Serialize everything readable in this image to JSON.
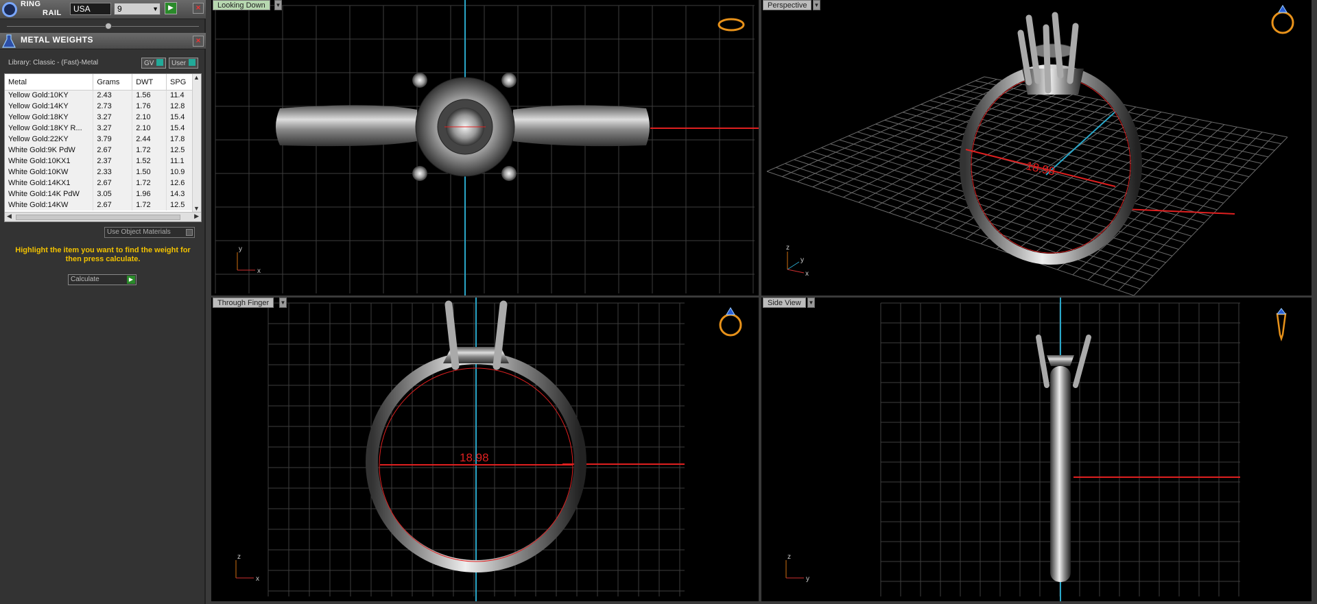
{
  "ring_rail": {
    "title_line1": "RING",
    "title_line2": "RAIL",
    "country": "USA",
    "size": "9"
  },
  "metal_weights": {
    "title": "METAL WEIGHTS",
    "library": "Library: Classic - (Fast)-Metal",
    "toggle_gv": "GV",
    "toggle_user": "User",
    "columns": [
      "Metal",
      "Grams",
      "DWT",
      "SPG"
    ],
    "rows": [
      [
        "Yellow Gold:10KY",
        "2.43",
        "1.56",
        "11.4"
      ],
      [
        "Yellow Gold:14KY",
        "2.73",
        "1.76",
        "12.8"
      ],
      [
        "Yellow Gold:18KY",
        "3.27",
        "2.10",
        "15.4"
      ],
      [
        "Yellow Gold:18KY R...",
        "3.27",
        "2.10",
        "15.4"
      ],
      [
        "Yellow Gold:22KY",
        "3.79",
        "2.44",
        "17.8"
      ],
      [
        "White Gold:9K PdW",
        "2.67",
        "1.72",
        "12.5"
      ],
      [
        "White Gold:10KX1",
        "2.37",
        "1.52",
        "11.1"
      ],
      [
        "White Gold:10KW",
        "2.33",
        "1.50",
        "10.9"
      ],
      [
        "White Gold:14KX1",
        "2.67",
        "1.72",
        "12.6"
      ],
      [
        "White Gold:14K PdW",
        "3.05",
        "1.96",
        "14.3"
      ],
      [
        "White Gold:14KW",
        "2.67",
        "1.72",
        "12.5"
      ]
    ],
    "use_object_materials": "Use Object Materials",
    "hint": "Highlight the item you want to find the weight for then press calculate.",
    "calculate": "Calculate"
  },
  "viewports": {
    "top_left": {
      "label": "Looking Down",
      "axis_a": "y",
      "axis_b": "x"
    },
    "top_right": {
      "label": "Perspective",
      "measure": "18.98",
      "axis_a": "z",
      "axis_b": "y",
      "axis_c": "x"
    },
    "bottom_left": {
      "label": "Through Finger",
      "measure": "18.98",
      "axis_a": "z",
      "axis_b": "x"
    },
    "bottom_right": {
      "label": "Side View",
      "axis_a": "z",
      "axis_b": "y"
    }
  },
  "colors": {
    "measure_red": "#e02020",
    "axis_cyan": "#2aa7c9",
    "hint_yellow": "#f2c200",
    "icon_orange": "#e8921a"
  }
}
